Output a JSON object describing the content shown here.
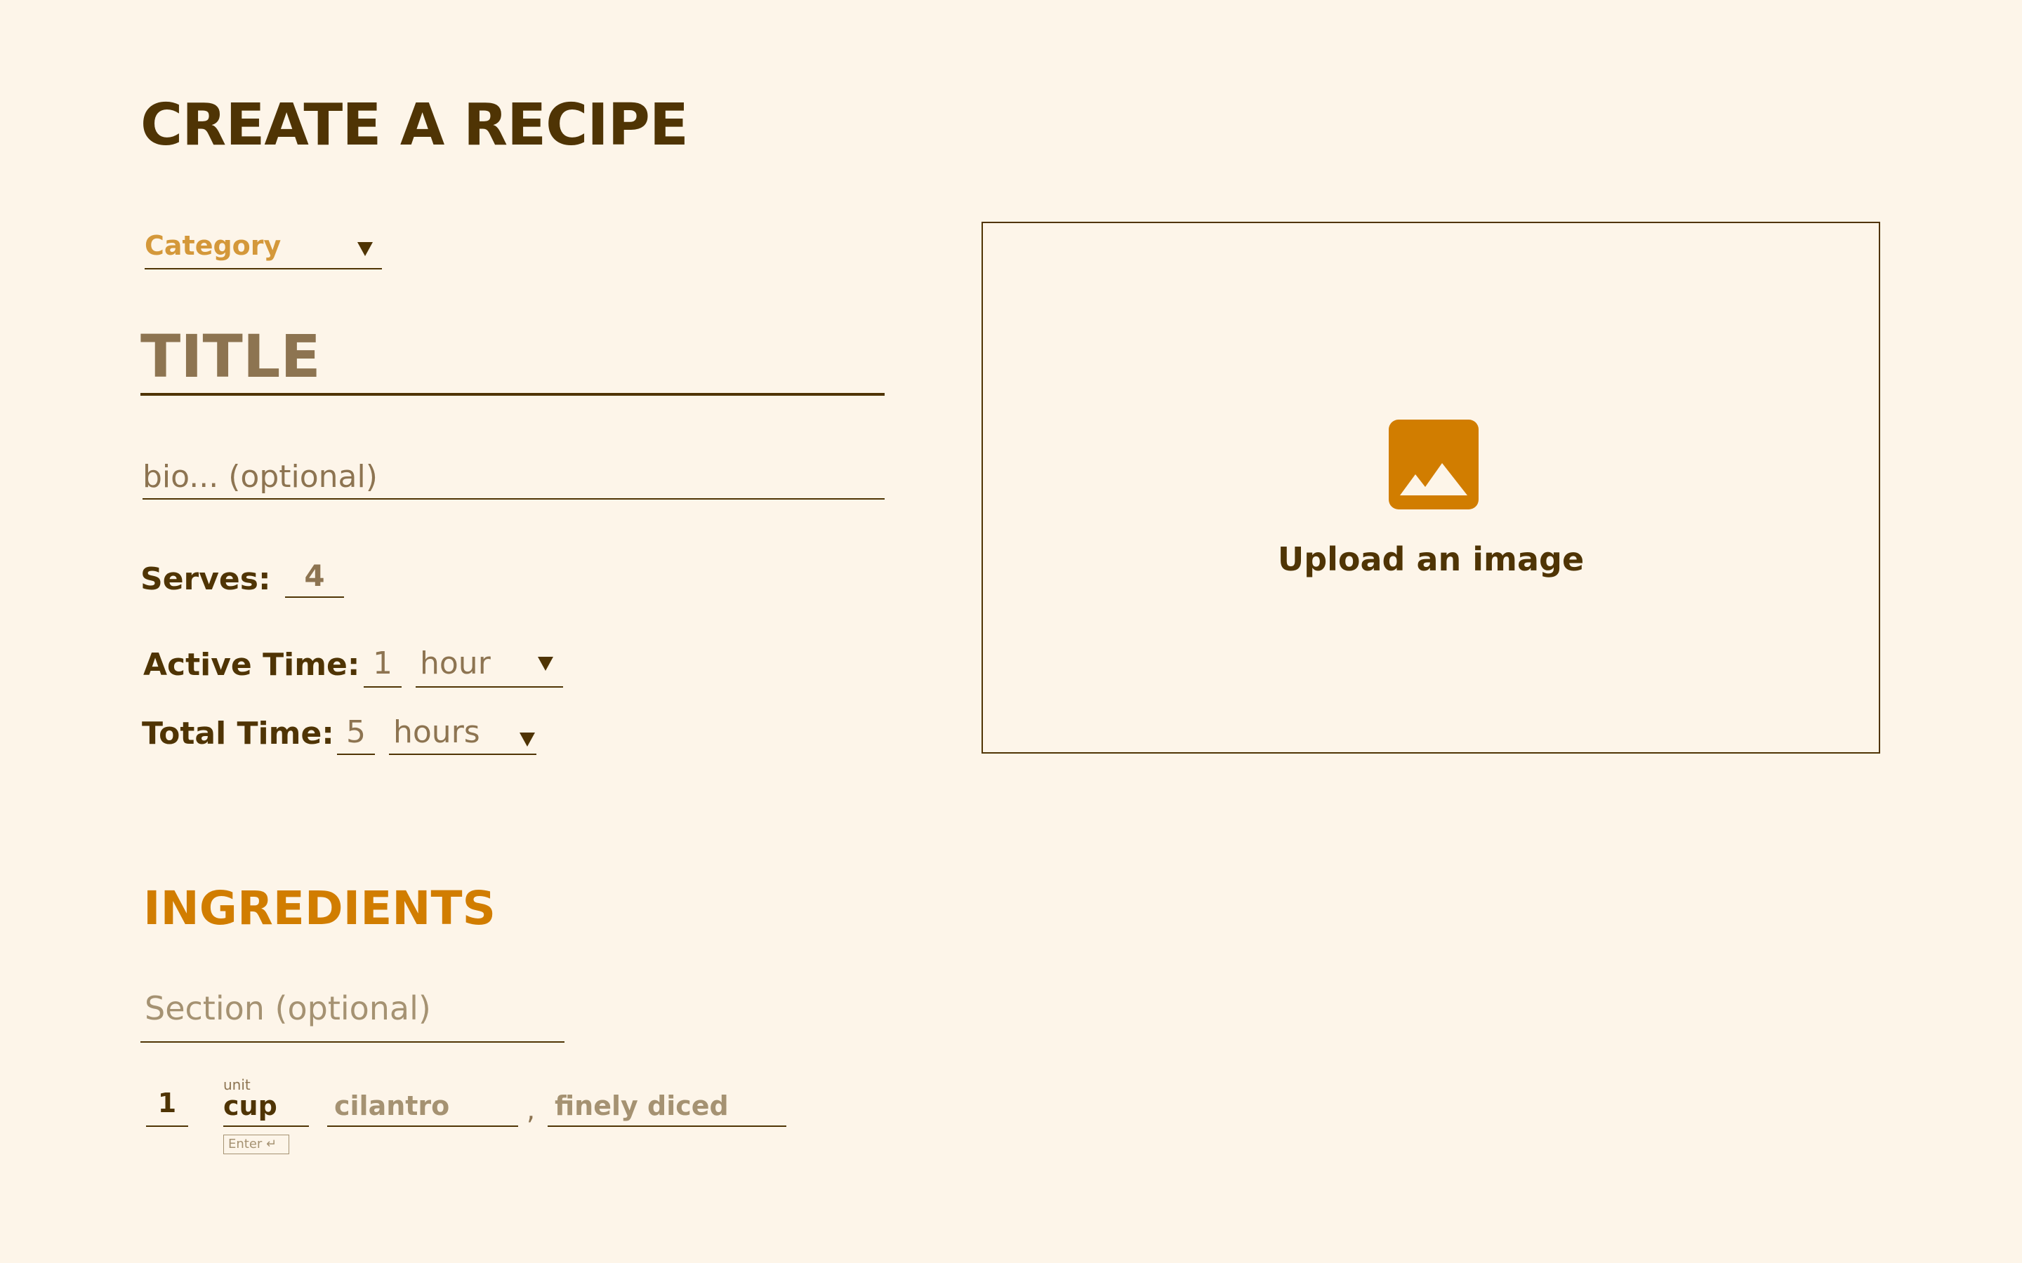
{
  "header": {
    "title": "CREATE A RECIPE"
  },
  "category": {
    "placeholder": "Category"
  },
  "title_input": {
    "placeholder": "TITLE"
  },
  "bio_input": {
    "placeholder": "bio... (optional)"
  },
  "serves": {
    "label": "Serves:",
    "value": "4"
  },
  "active_time": {
    "label": "Active Time:",
    "value": "1",
    "unit": "hour"
  },
  "total_time": {
    "label": "Total Time:",
    "value": "5",
    "unit": "hours"
  },
  "upload": {
    "label": "Upload an image",
    "icon": "image-icon"
  },
  "ingredients": {
    "heading": "INGREDIENTS",
    "section_placeholder": "Section (optional)",
    "row": {
      "quantity": "1",
      "unit_caption": "unit",
      "unit": "cup",
      "enter_hint": "Enter ↵",
      "name_placeholder": "cilantro",
      "separator": ",",
      "prep_placeholder": "finely diced"
    }
  },
  "colors": {
    "background": "#fdf5e9",
    "text_dark": "#4f3404",
    "accent": "#d17d00",
    "placeholder": "#8d7451",
    "category_text": "#d4983a"
  }
}
